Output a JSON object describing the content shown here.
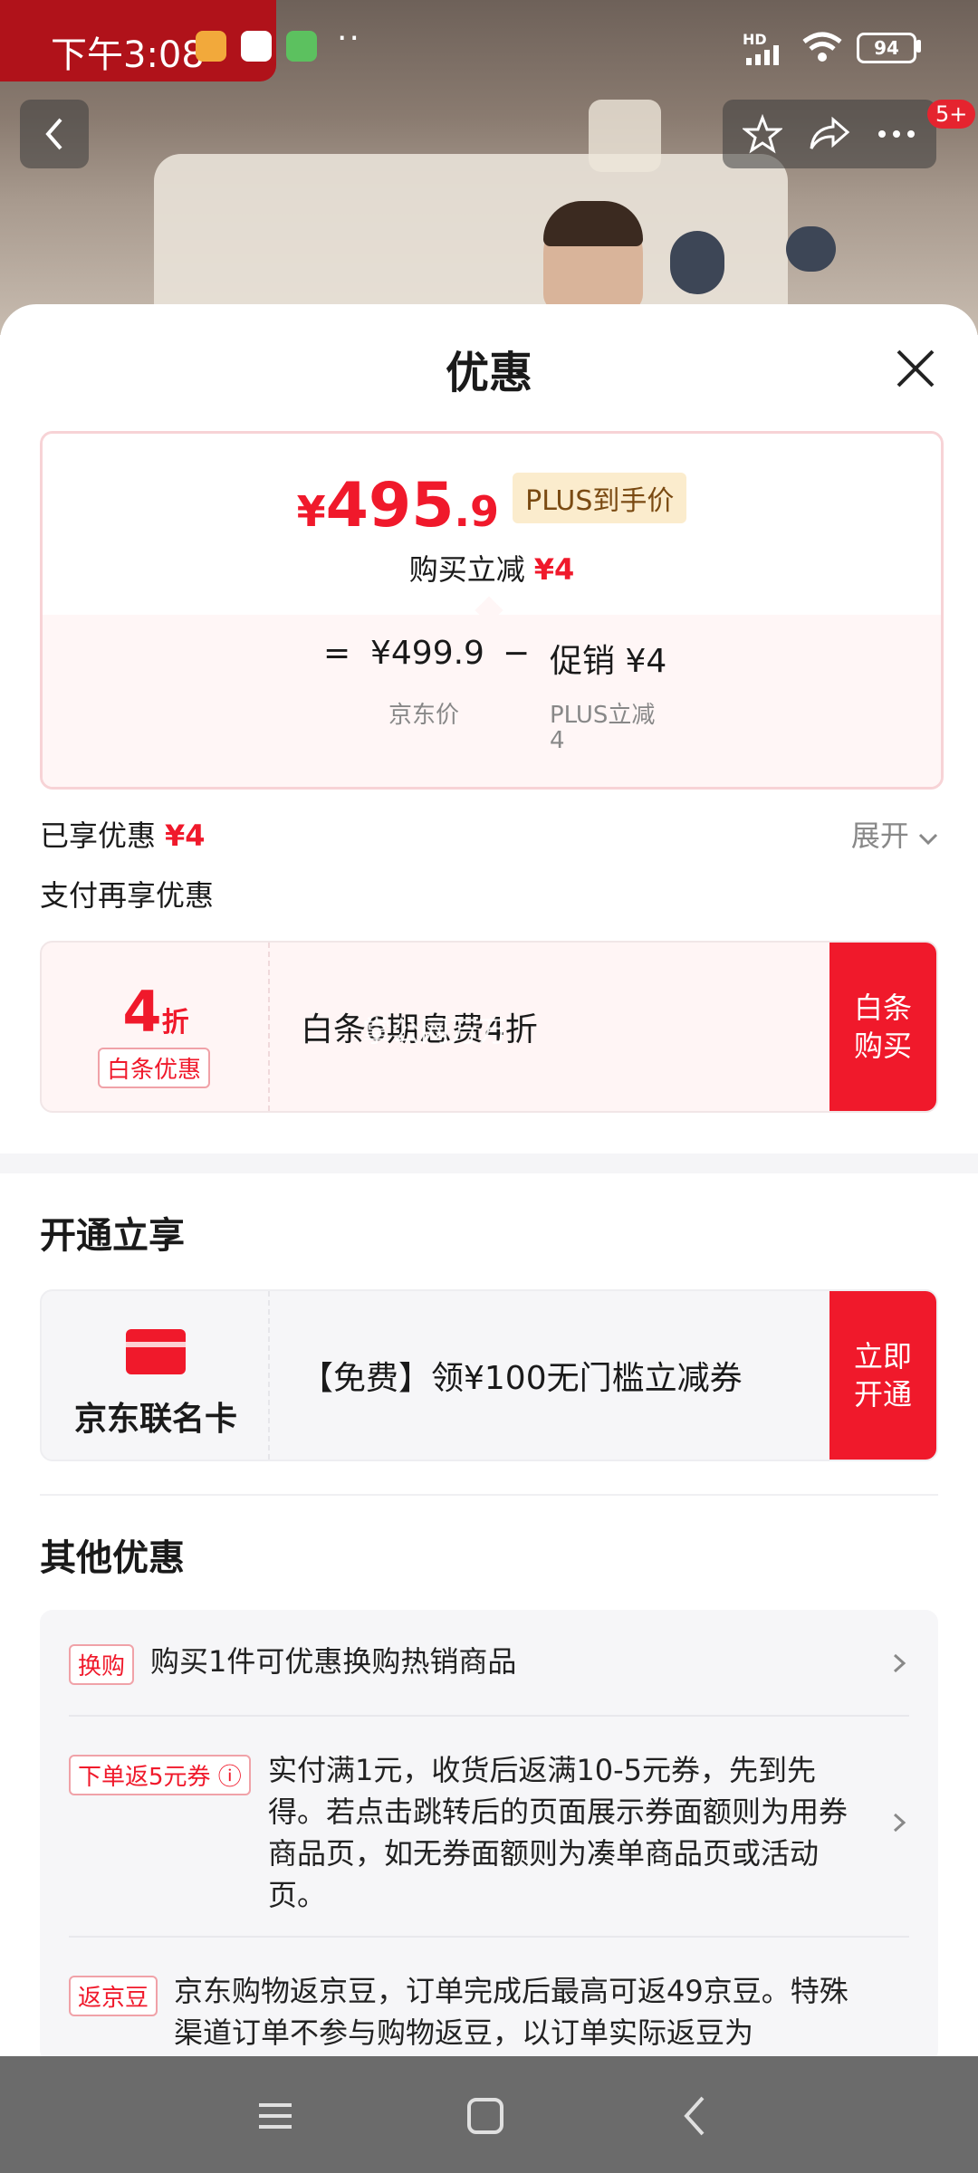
{
  "status_bar": {
    "time": "下午3:08",
    "network": "HD",
    "battery": "94"
  },
  "top_nav": {
    "badge": "5+"
  },
  "sheet": {
    "title": "优惠"
  },
  "price_card": {
    "currency": "¥",
    "price_int": "495",
    "price_dec": ".9",
    "plus_tag": "PLUS到手价",
    "instant_reduce_label": "购买立减",
    "instant_reduce_value": "¥4",
    "formula_eq": "=",
    "jd_price": "¥499.9",
    "formula_minus": "−",
    "promo": "促销 ¥4",
    "jd_price_label": "京东价",
    "promo_label_line1": "PLUS立减",
    "promo_label_line2": "4"
  },
  "enjoyed": {
    "label": "已享优惠",
    "value": "¥4",
    "expand": "展开"
  },
  "pay_more_label": "支付再享优惠",
  "baitiao": {
    "discount_num": "4",
    "discount_unit": "折",
    "tag": "白条优惠",
    "desc": "白条6期息费4折",
    "button_line1": "白条",
    "button_line2": "购买",
    "watermark": "掌公网万万"
  },
  "open_section": {
    "title": "开通立享"
  },
  "cobrand": {
    "name": "京东联名卡",
    "desc": "【免费】领¥100无门槛立减券",
    "button_line1": "立即",
    "button_line2": "开通"
  },
  "other_section": {
    "title": "其他优惠",
    "items": [
      {
        "tag": "换购",
        "desc": "购买1件可优惠换购热销商品"
      },
      {
        "tag": "下单返5元券 ⓘ",
        "desc": "实付满1元，收货后返满10-5元券，先到先得。若点击跳转后的页面展示券面额则为用券商品页，如无券面额则为凑单商品页或活动页。"
      },
      {
        "tag": "返京豆",
        "desc": "京东购物返京豆，订单完成后最高可返49京豆。特殊渠道订单不参与购物返豆，以订单实际返豆为"
      }
    ]
  },
  "icons": [
    "back-icon",
    "star-icon",
    "share-icon",
    "more-icon",
    "close-icon",
    "chevron-down-icon",
    "card-icon",
    "chevron-right-icon",
    "menu-icon",
    "home-icon",
    "nav-back-icon"
  ],
  "colors": {
    "accent": "#f0192b",
    "plus_tag_bg": "#fbeccd",
    "nav_bar": "#6b6b6b"
  }
}
